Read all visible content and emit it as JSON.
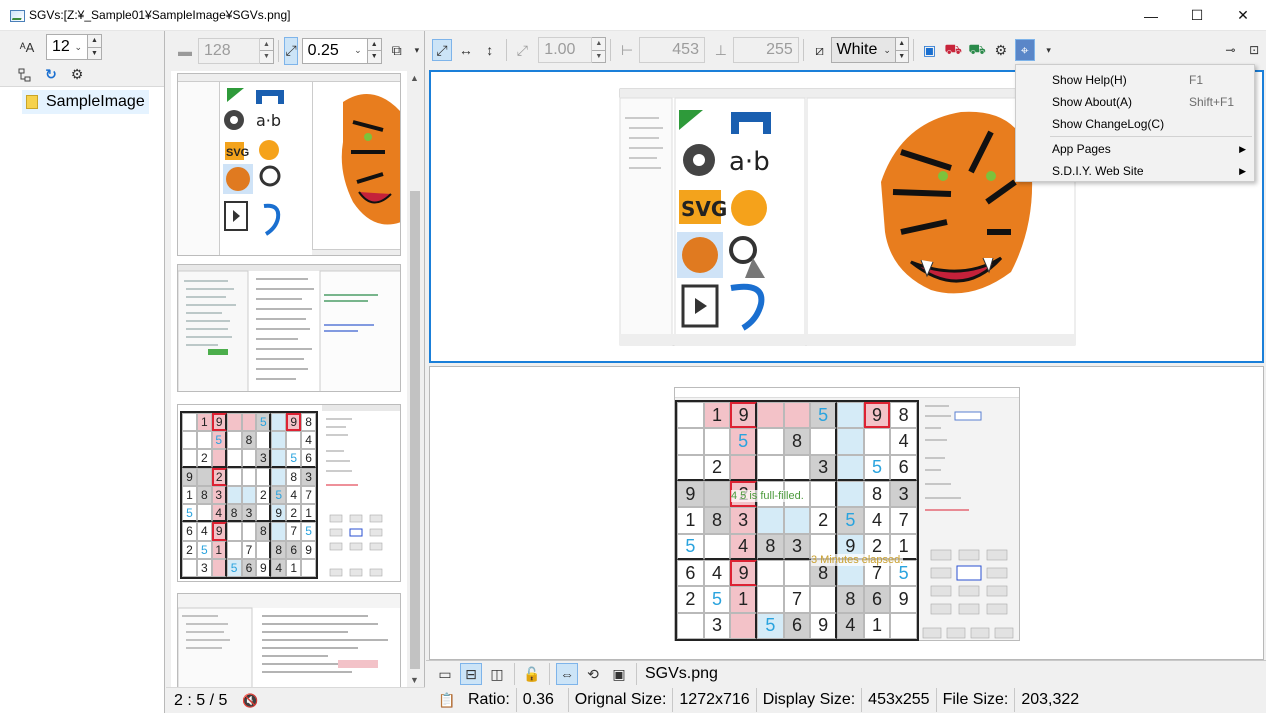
{
  "window": {
    "title": "SGVs:[Z:¥_Sample01¥SampleImage¥SGVs.png]",
    "controls": [
      "—",
      "☐",
      "✕"
    ]
  },
  "left_panel": {
    "font_size_value": "12",
    "tree_item": "SampleImage"
  },
  "thumb_panel": {
    "size_value": "128",
    "zoom_value": "0.25",
    "status": "2 : 5 / 5"
  },
  "main_toolbar": {
    "ratio_value": "1.00",
    "width_value": "453",
    "height_value": "255",
    "background_select": "White"
  },
  "menu": {
    "items": [
      {
        "label": "Show Help(H)",
        "shortcut": "F1"
      },
      {
        "label": "Show About(A)",
        "shortcut": "Shift+F1"
      },
      {
        "label": "Show ChangeLog(C)",
        "shortcut": ""
      },
      {
        "label": "App Pages",
        "shortcut": ""
      },
      {
        "label": "S.D.I.Y. Web Site",
        "shortcut": ""
      }
    ]
  },
  "bottom_toolbar": {
    "file_name": "SGVs.png"
  },
  "statusbar": {
    "ratio_label": "Ratio:",
    "ratio_value": "0.36",
    "original_size_label": "Orignal Size:",
    "original_size_value": "1272x716",
    "display_size_label": "Display Size:",
    "display_size_value": "453x255",
    "file_size_label": "File Size:",
    "file_size_value": "203,322"
  },
  "sudoku_preview": {
    "rows": [
      [
        "",
        "1",
        "9",
        "",
        "",
        "5",
        "",
        "9",
        "8"
      ],
      [
        "",
        "",
        "5",
        "",
        "8",
        "",
        "",
        "",
        "4"
      ],
      [
        "",
        "2",
        "",
        "",
        "",
        "3",
        "",
        "5",
        "6"
      ],
      [
        "9",
        "",
        "2",
        "",
        "",
        "",
        "",
        "8",
        "3"
      ],
      [
        "1",
        "8",
        "3",
        "",
        "",
        "2",
        "5",
        "4",
        "7"
      ],
      [
        "5",
        "",
        "4",
        "8",
        "3",
        "",
        "9",
        "2",
        "1"
      ],
      [
        "6",
        "4",
        "9",
        "",
        "",
        "8",
        "",
        "7",
        "5"
      ],
      [
        "2",
        "5",
        "1",
        "",
        "7",
        "",
        "8",
        "6",
        "9"
      ],
      [
        "",
        "3",
        "",
        "5",
        "6",
        "9",
        "4",
        "1",
        ""
      ]
    ],
    "overlay_1": "4 5 is full-filled.",
    "overlay_2": "3 Minutes elapsed."
  },
  "colors": {
    "accent": "#1a7fd9",
    "selection": "#cce4f7"
  }
}
